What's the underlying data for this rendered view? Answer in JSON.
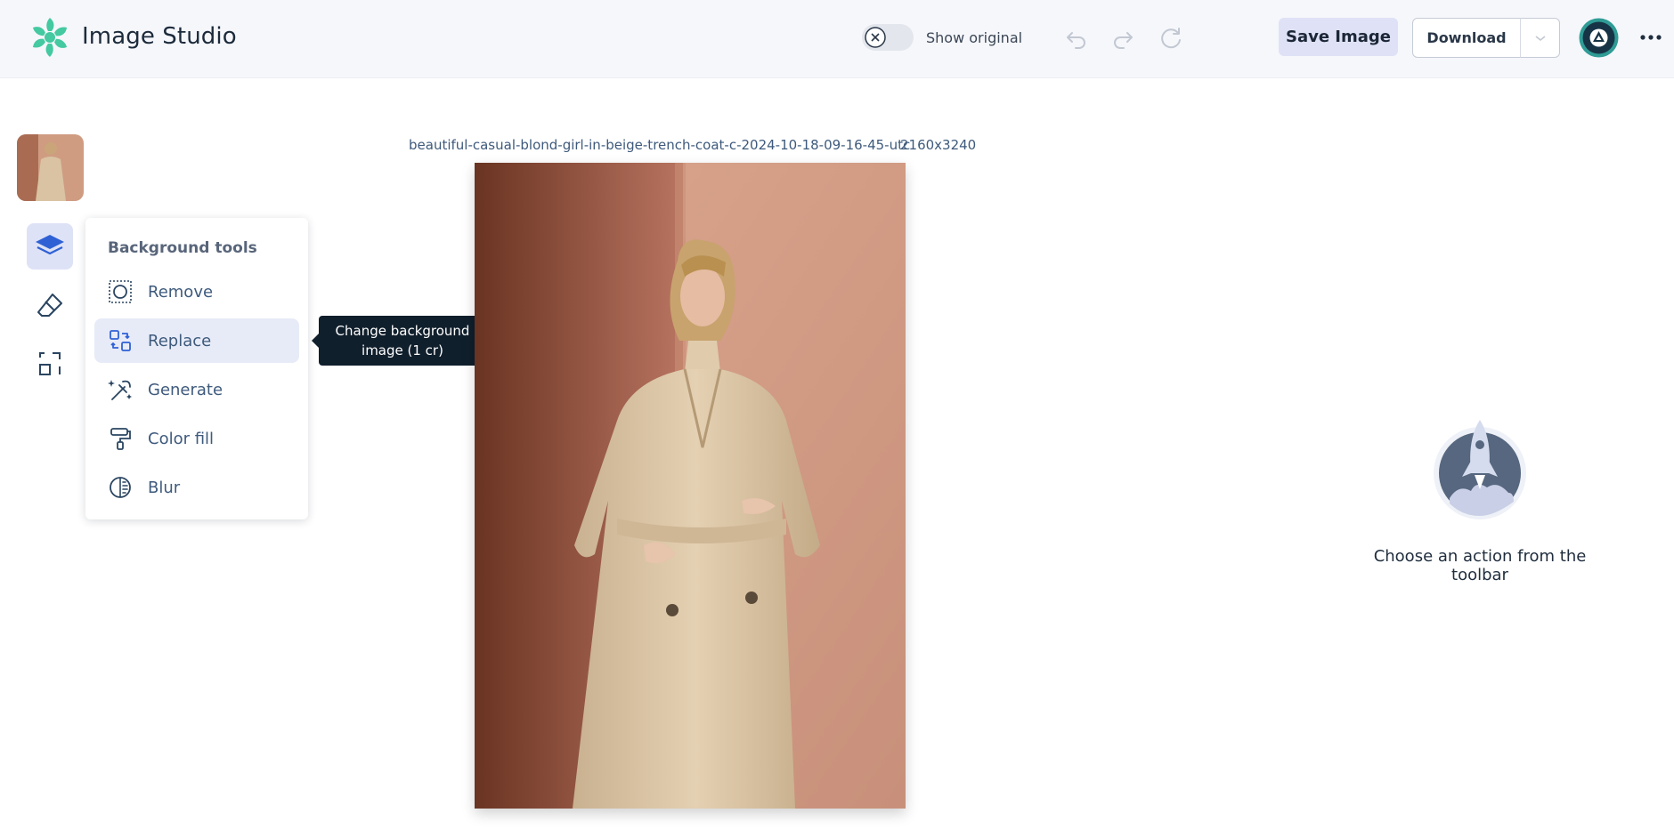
{
  "header": {
    "app_title": "Image Studio",
    "show_original_label": "Show original",
    "save_label": "Save Image",
    "download_label": "Download"
  },
  "popover": {
    "title": "Background tools",
    "items": [
      {
        "label": "Remove",
        "icon": "remove-bg-icon"
      },
      {
        "label": "Replace",
        "icon": "replace-icon"
      },
      {
        "label": "Generate",
        "icon": "magic-wand-icon"
      },
      {
        "label": "Color fill",
        "icon": "paint-roller-icon"
      },
      {
        "label": "Blur",
        "icon": "blur-icon"
      }
    ],
    "active_item": "Replace"
  },
  "tooltip": {
    "text": "Change background image (1 cr)"
  },
  "canvas": {
    "file_name": "beautiful-casual-blond-girl-in-beige-trench-coat-c-2024-10-18-09-16-45-utc",
    "dimensions": "2160x3240"
  },
  "empty_state": {
    "message": "Choose an action from the toolbar"
  },
  "colors": {
    "accent": "#3f68d8",
    "header_bg": "#f6f7fb",
    "active_bg": "#dde2f6",
    "logo": "#44c9a1",
    "tooltip_bg": "#101f2c"
  }
}
